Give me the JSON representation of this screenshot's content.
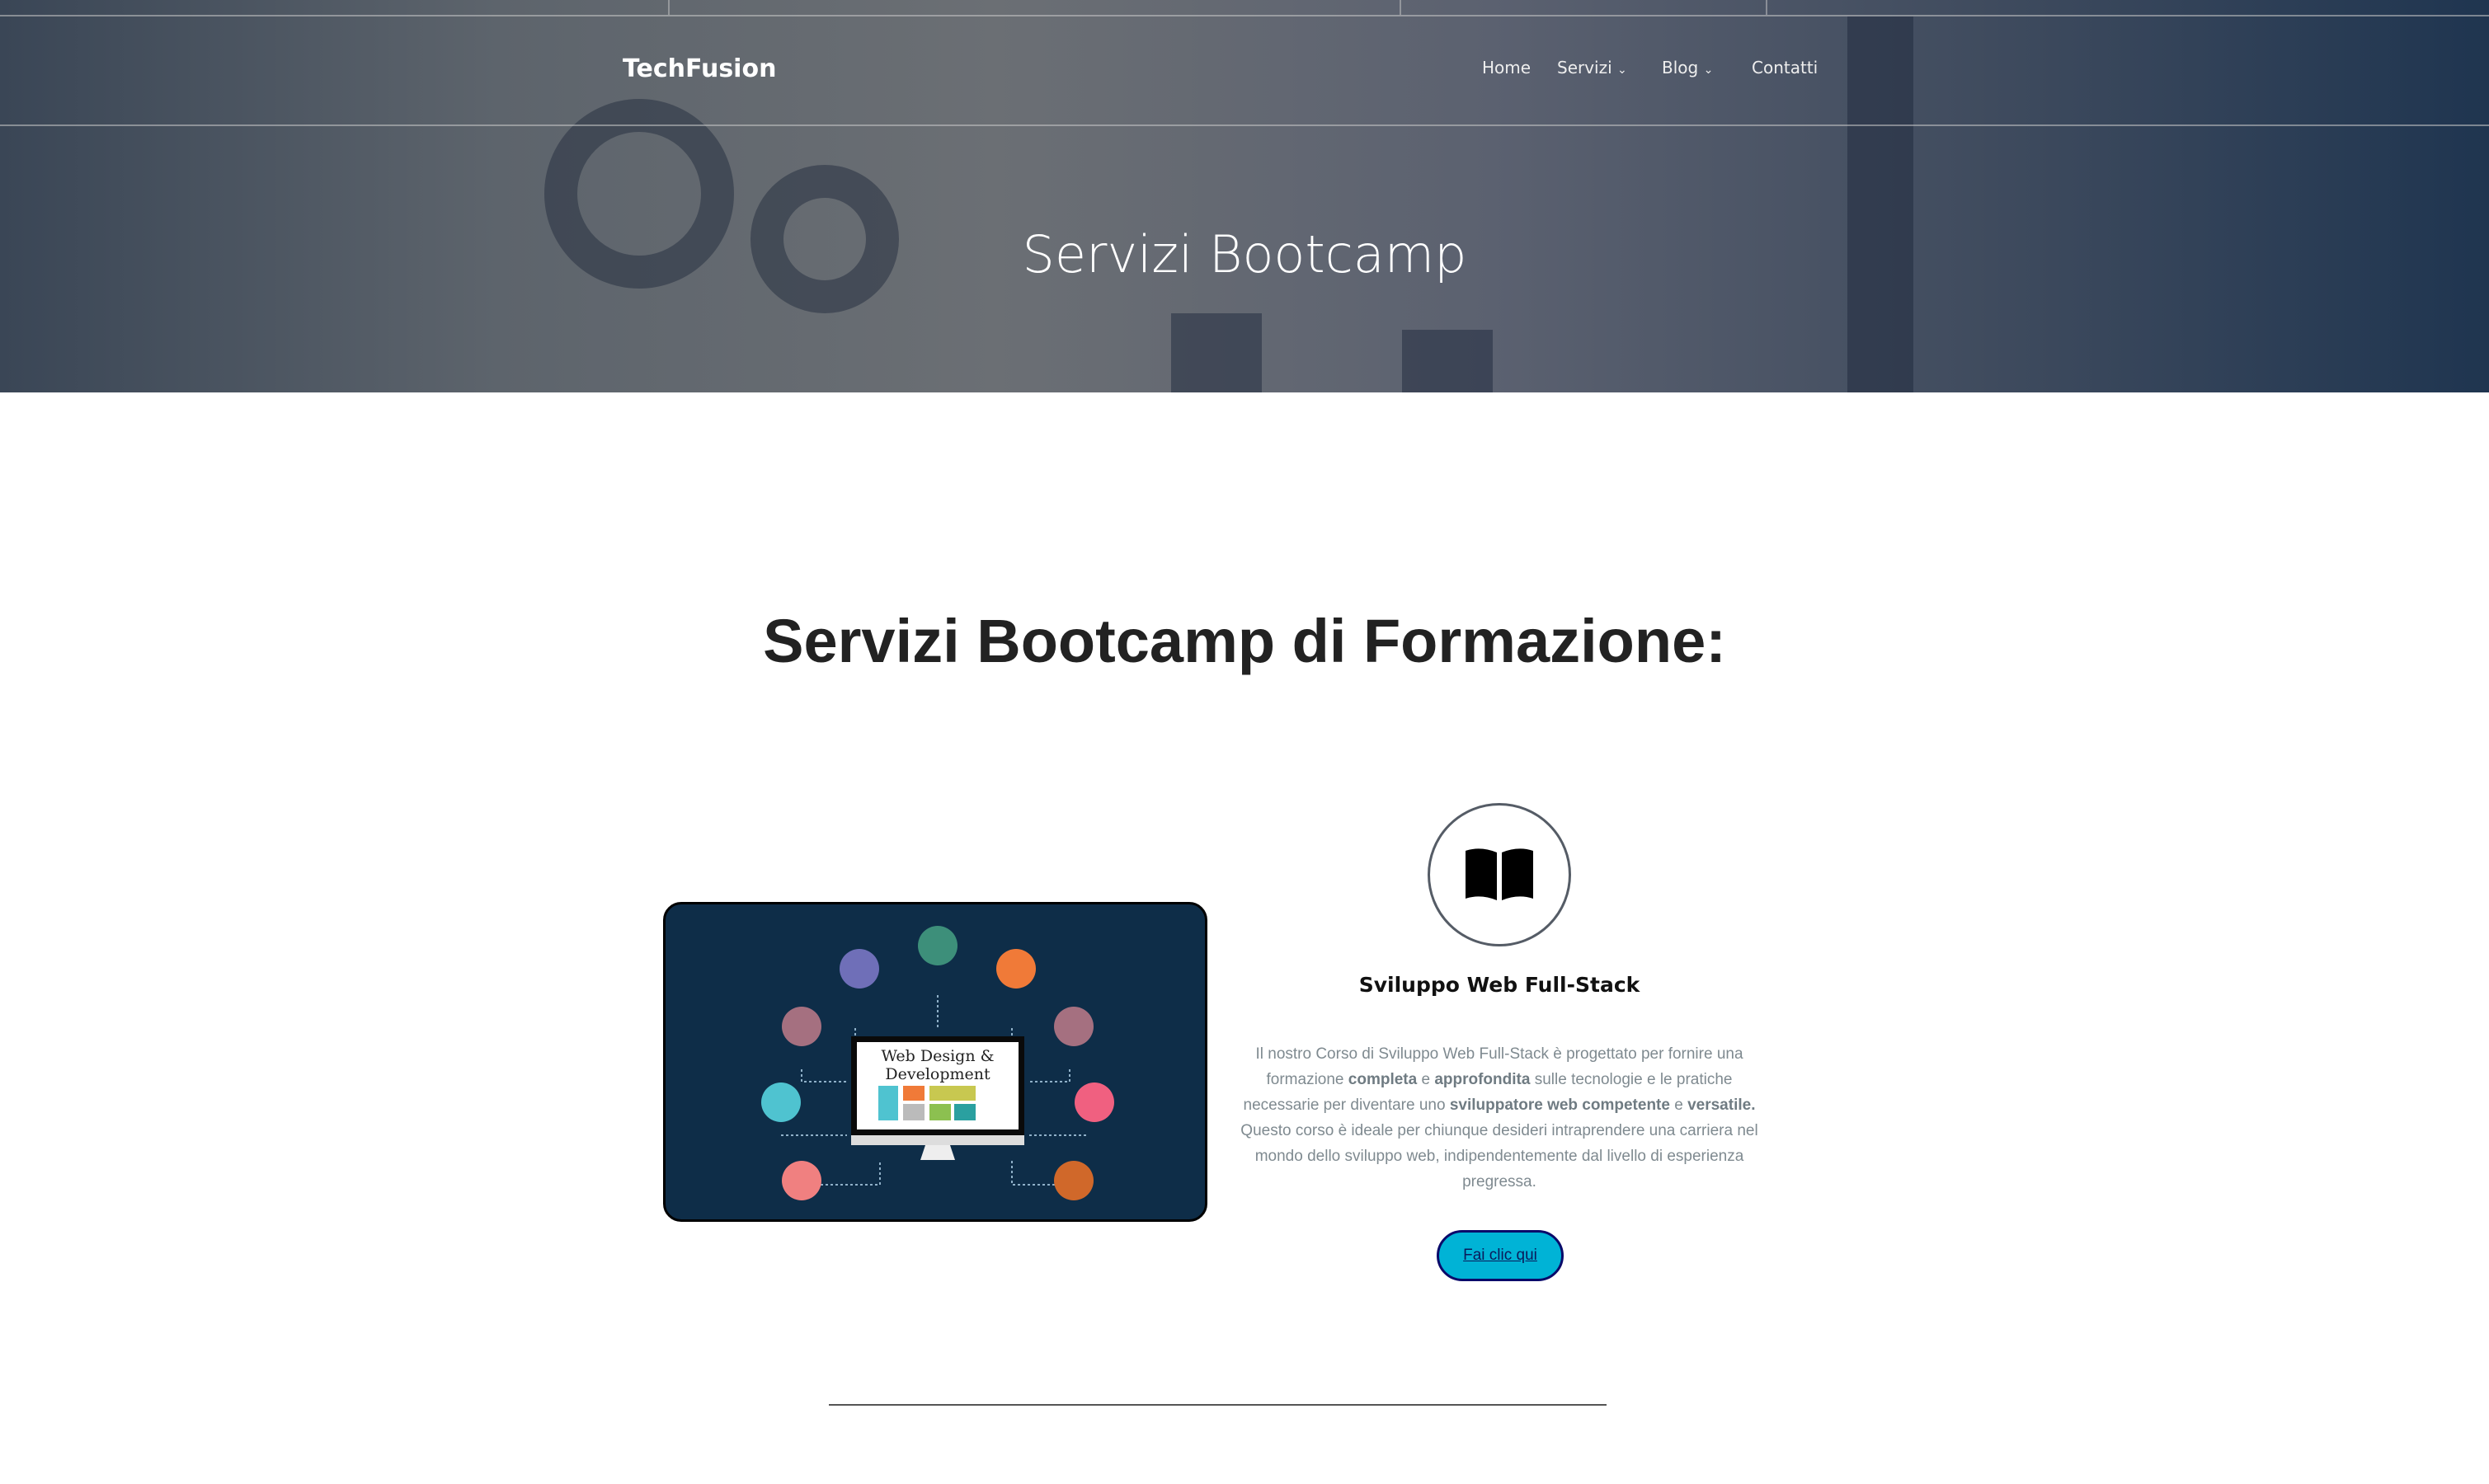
{
  "header": {
    "logo": "TechFusion",
    "nav": [
      {
        "label": "Home"
      },
      {
        "label": "Servizi",
        "dropdown": true
      },
      {
        "label": "Blog",
        "dropdown": true
      },
      {
        "label": "Contatti"
      }
    ]
  },
  "hero": {
    "title": "Servizi Bootcamp"
  },
  "main": {
    "heading": "Servizi Bootcamp di Formazione:",
    "image_text": [
      "Web Design &",
      "Development"
    ],
    "card": {
      "icon": "open-book-icon",
      "title": "Sviluppo Web Full-Stack",
      "p": [
        "Il nostro Corso di Sviluppo Web Full-Stack è progettato per fornire una formazione ",
        "completa",
        " e ",
        "approfondita",
        " sulle tecnologie e le pratiche necessarie per diventare uno ",
        "sviluppatore web competente",
        " e ",
        "versatile.",
        " Questo corso è ideale per chiunque desideri intraprendere una carriera nel mondo dello sviluppo web, indipendentemente dal livello di esperienza pregressa."
      ],
      "button": "Fai clic qui"
    }
  },
  "colors": {
    "button": "#00b3d6",
    "image_bg": "#0e2d48"
  }
}
